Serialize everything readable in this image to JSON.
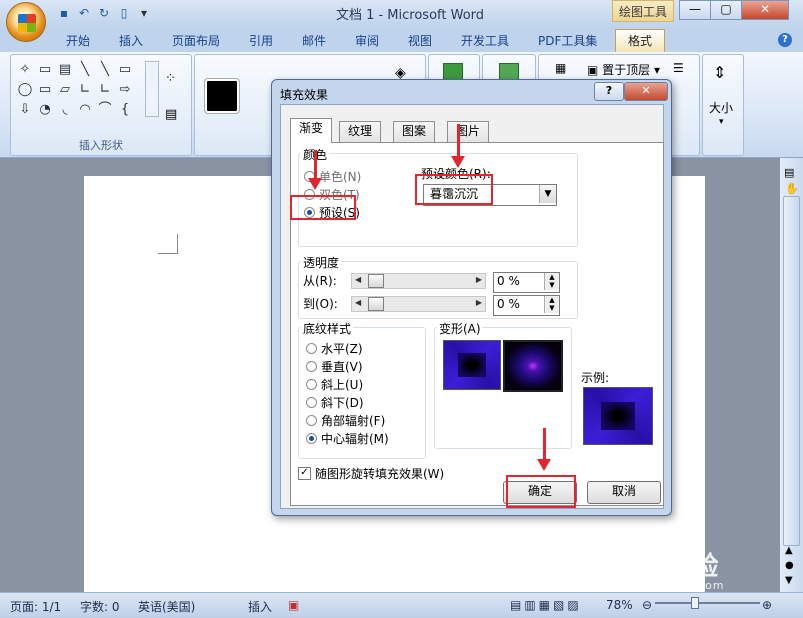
{
  "window": {
    "title": "文档 1 - Microsoft Word",
    "context_tab_label": "绘图工具",
    "controls": [
      "—",
      "▢",
      "✕"
    ]
  },
  "qat": {
    "icons": [
      "save-icon",
      "undo-icon",
      "redo-icon",
      "print-preview-icon",
      "customize-icon"
    ]
  },
  "tabs": [
    "开始",
    "插入",
    "页面布局",
    "引用",
    "邮件",
    "审阅",
    "视图",
    "开发工具",
    "PDF工具集",
    "格式"
  ],
  "active_tab": "格式",
  "ribbon": {
    "group_insert_shapes": "插入形状",
    "shape_glyphs": [
      "✧",
      "▭",
      "▤",
      "╲",
      "╲",
      "▭",
      "◯",
      "▭",
      "▱",
      "∟",
      "∟",
      "⇨",
      "⇩",
      "◔",
      "◟",
      "◠",
      "⌒",
      "{"
    ],
    "arrange_bring_front": "置于顶层",
    "size_label": "大小"
  },
  "dialog": {
    "title": "填充效果",
    "help_label": "?",
    "close_label": "✕",
    "tabs": [
      "渐变",
      "纹理",
      "图案",
      "图片"
    ],
    "active_tab": "渐变",
    "colors_legend": "颜色",
    "color_options": [
      "单色(N)",
      "双色(T)",
      "预设(S)"
    ],
    "selected_color_option": "预设(S)",
    "preset_label": "预设颜色(R):",
    "preset_value": "暮霭沉沉",
    "transparency_legend": "透明度",
    "from_label": "从(R):",
    "to_label": "到(O):",
    "from_value": "0 %",
    "to_value": "0 %",
    "from_level_percent": 0,
    "to_level_percent": 0,
    "shading_legend": "底纹样式",
    "shading_options": [
      "水平(Z)",
      "垂直(V)",
      "斜上(U)",
      "斜下(D)",
      "角部辐射(F)",
      "中心辐射(M)"
    ],
    "selected_shading": "中心辐射(M)",
    "variants_legend": "变形(A)",
    "sample_label": "示例:",
    "rotate_with_shape_label": "随图形旋转填充效果(W)",
    "rotate_with_shape_checked": true,
    "ok_label": "确定",
    "cancel_label": "取消"
  },
  "statusbar": {
    "page": "页面: 1/1",
    "words": "字数: 0",
    "language": "英语(美国)",
    "mode": "插入",
    "zoom": "78%"
  },
  "watermark": {
    "brand": "Bai 经验",
    "url": "jingyan.baidu.com"
  },
  "annotation_color": "#e0262f"
}
